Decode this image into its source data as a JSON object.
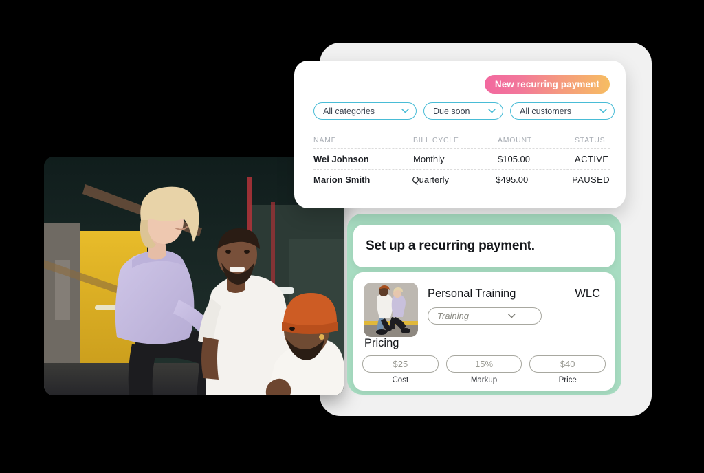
{
  "cards": {
    "recurring_payments": {
      "badge_label": "New recurring payment",
      "filters": [
        {
          "name": "all-categories",
          "label": "All categories"
        },
        {
          "name": "due-soon",
          "label": "Due soon"
        },
        {
          "name": "all-customers",
          "label": "All customers"
        }
      ],
      "table": {
        "columns": [
          "NAME",
          "BILL CYCLE",
          "AMOUNT",
          "STATUS"
        ],
        "rows": [
          {
            "name": "Wei Johnson",
            "cycle": "Monthly",
            "amount": "$105.00",
            "status": "ACTIVE"
          },
          {
            "name": "Marion Smith",
            "cycle": "Quarterly",
            "amount": "$495.00",
            "status": "PAUSED"
          }
        ]
      }
    },
    "setup": {
      "title": "Set up a recurring payment.",
      "service_name": "Personal Training",
      "service_code": "WLC",
      "category_placeholder": "Training",
      "pricing_label": "Pricing",
      "pricing_fields": [
        {
          "name": "cost",
          "value": "$25",
          "caption": "Cost"
        },
        {
          "name": "markup",
          "value": "15%",
          "caption": "Markup"
        },
        {
          "name": "price",
          "value": "$40",
          "caption": "Price"
        }
      ]
    }
  },
  "colors": {
    "badge_from": "#f2689f",
    "badge_to": "#f6bd62",
    "filter_border": "#49bcd6",
    "status_active": "#5ed3a9",
    "status_paused": "#fa8fa9",
    "green_card": "#a7dcc1"
  },
  "icons": {
    "chevron_down": "chevron-down-icon"
  }
}
